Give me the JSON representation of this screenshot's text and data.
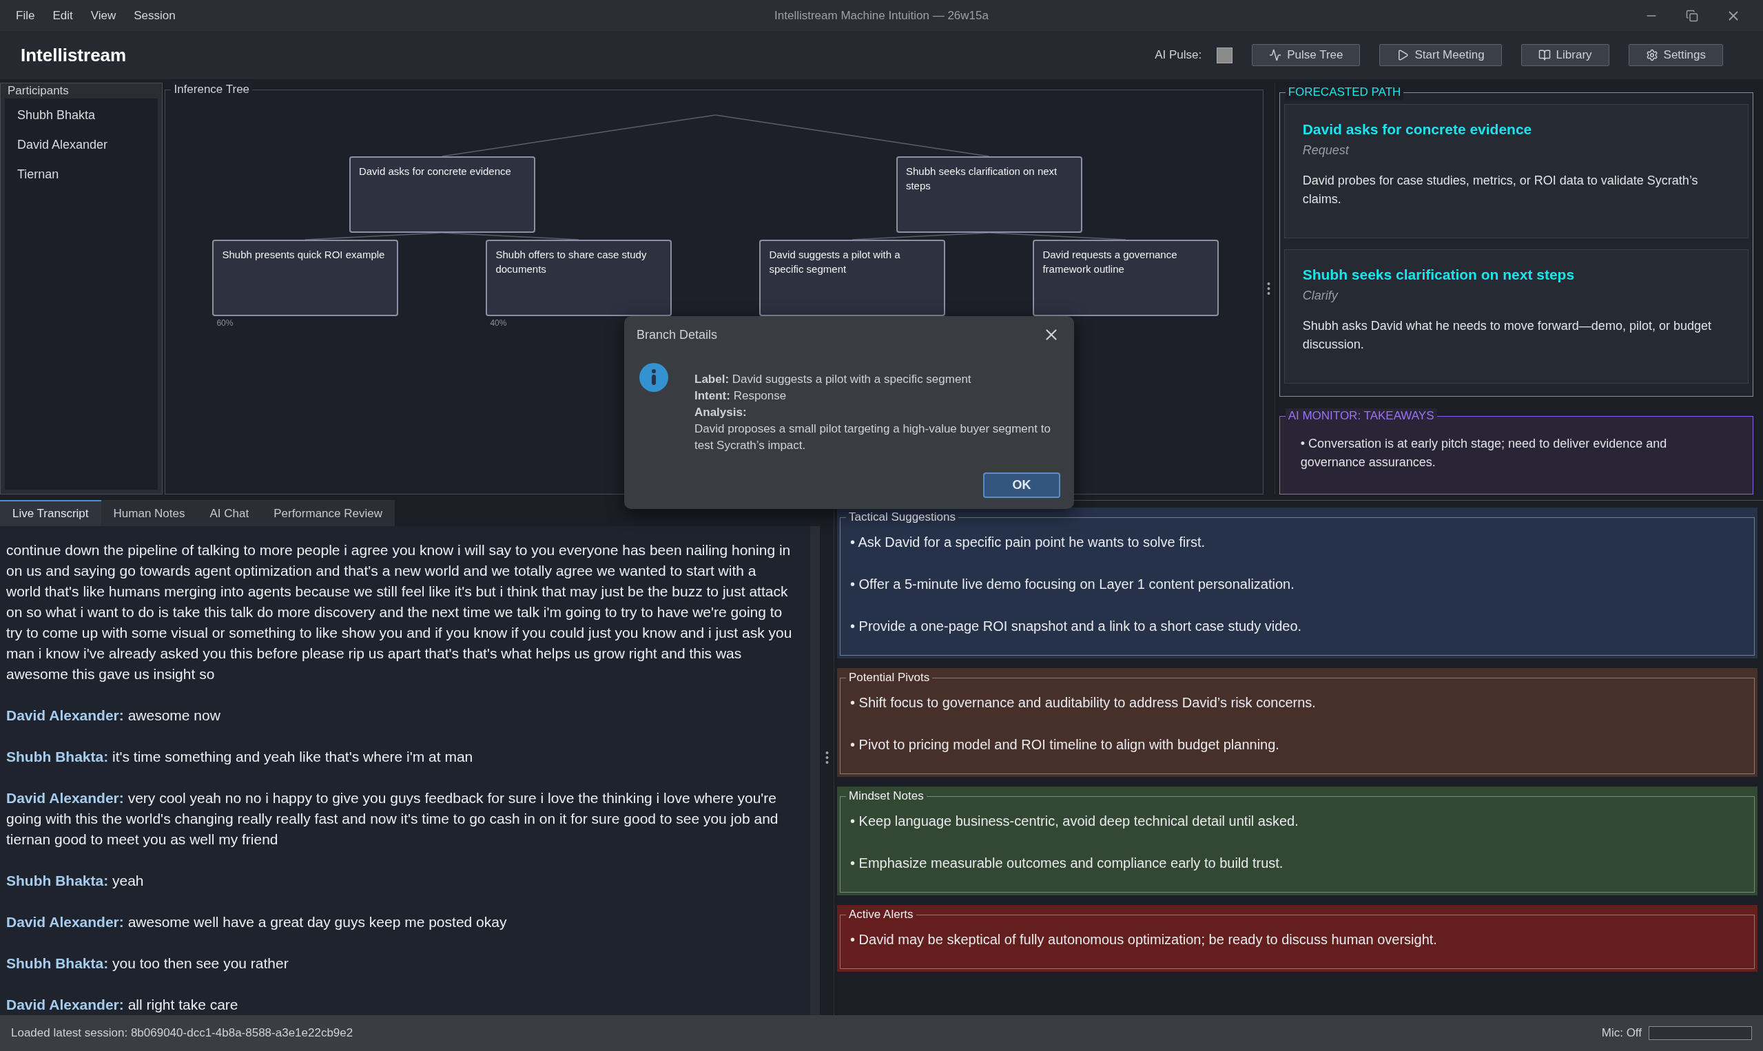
{
  "window": {
    "title": "Intellistream Machine Intuition — 26w15a",
    "menu": [
      "File",
      "Edit",
      "View",
      "Session"
    ]
  },
  "header": {
    "app_name": "Intellistream",
    "pulse_label": "AI Pulse:",
    "pulse_active": false,
    "buttons": [
      {
        "label": "Pulse Tree",
        "kind": "pulse"
      },
      {
        "label": "Start Meeting",
        "kind": "play"
      },
      {
        "label": "Library",
        "kind": "book"
      },
      {
        "label": "Settings",
        "kind": "gear"
      }
    ]
  },
  "participants": {
    "title": "Participants",
    "items": [
      "Shubh Bhakta",
      "David Alexander",
      "Tiernan"
    ]
  },
  "inference_tree": {
    "title": "Inference Tree",
    "nodes": [
      {
        "label": "David asks for concrete evidence",
        "children": [
          {
            "label": "Shubh presents quick ROI example",
            "percent": "60%"
          },
          {
            "label": "Shubh offers to share case study documents",
            "percent": "40%"
          }
        ]
      },
      {
        "label": "Shubh seeks clarification on next steps",
        "children": [
          {
            "label": "David suggests a pilot with a specific segment"
          },
          {
            "label": "David requests a governance framework outline"
          }
        ]
      }
    ]
  },
  "forecasted_path": {
    "title": "FORECASTED PATH",
    "cards": [
      {
        "title": "David asks for concrete evidence",
        "intent": "Request",
        "description": "David probes for case studies, metrics, or ROI data to validate Sycrath’s claims."
      },
      {
        "title": "Shubh seeks clarification on next steps",
        "intent": "Clarify",
        "description": "Shubh asks David what he needs to move forward—demo, pilot, or budget discussion."
      }
    ]
  },
  "takeaways": {
    "title": "AI MONITOR: TAKEAWAYS",
    "items": [
      "• Conversation is at early pitch stage; need to deliver evidence and governance assurances."
    ]
  },
  "tabs": [
    {
      "label": "Live Transcript",
      "selected": true
    },
    {
      "label": "Human Notes",
      "selected": false
    },
    {
      "label": "AI Chat",
      "selected": false
    },
    {
      "label": "Performance Review",
      "selected": false
    }
  ],
  "transcript": [
    {
      "text": "continue down the pipeline of talking to more people i agree you know i will say to you everyone has been nailing honing in on us and saying go towards agent optimization and that's a new world and we totally agree we wanted to start with a world that's like humans merging into agents because we still feel like it's but i think that may just be the buzz to just attack on so what i want to do is take this talk do more discovery and the next time we talk i'm going to try to have we're going to try to come up with some visual or something to like show you and if you know if you could just you know and i just ask you man i know i've already asked you this before please rip us apart that's that's what helps us grow right and this was awesome this gave us insight so"
    },
    {
      "speaker": "David Alexander:",
      "text": "awesome now"
    },
    {
      "speaker": "Shubh Bhakta:",
      "text": "it's time something and yeah like that's where i'm at man"
    },
    {
      "speaker": "David Alexander:",
      "text": "very cool yeah no no i happy to give you guys feedback for sure i love the thinking i love where you're going with this the world's changing really really fast and now it's time to go cash in on it for sure good to see you job and tiernan good to meet you as well my friend"
    },
    {
      "speaker": "Shubh Bhakta:",
      "text": "yeah"
    },
    {
      "speaker": "David Alexander:",
      "text": "awesome well have a great day guys keep me posted okay"
    },
    {
      "speaker": "Shubh Bhakta:",
      "text": "you too then see you rather"
    },
    {
      "speaker": "David Alexander:",
      "text": "all right take care"
    }
  ],
  "simulations": [
    {
      "title": "Tactical Suggestions",
      "color": "#26324a",
      "items": [
        "• Ask David for a specific pain point he wants to solve first.",
        "• Offer a 5-minute live demo focusing on Layer 1 content personalization.",
        "• Provide a one-page ROI snapshot and a link to a short case study video."
      ]
    },
    {
      "title": "Potential Pivots",
      "color": "#47302a",
      "items": [
        "• Shift focus to governance and auditability to address David’s risk concerns.",
        "• Pivot to pricing model and ROI timeline to align with budget planning."
      ]
    },
    {
      "title": "Mindset Notes",
      "color": "#334832",
      "items": [
        "• Keep language business-centric, avoid deep technical detail until asked.",
        "• Emphasize measurable outcomes and compliance early to build trust."
      ]
    },
    {
      "title": "Active Alerts",
      "color": "#641e1e",
      "items": [
        "• David may be skeptical of fully autonomous optimization; be ready to discuss human oversight."
      ]
    }
  ],
  "dialog": {
    "title": "Branch Details",
    "fields": [
      {
        "key": "Label:",
        "value": "David suggests a pilot with a specific segment"
      },
      {
        "key": "Intent:",
        "value": "Response"
      },
      {
        "key": "Analysis:"
      }
    ],
    "analysis": "David proposes a small pilot targeting a high-value buyer segment to test Sycrath’s impact.",
    "button": "OK"
  },
  "status_bar": {
    "message": "Loaded latest session: 8b069040-dcc1-4b8a-8588-a3e1e22cb9e2",
    "mic_label": "Mic: Off",
    "mic_meter": {
      "level": 0
    }
  }
}
